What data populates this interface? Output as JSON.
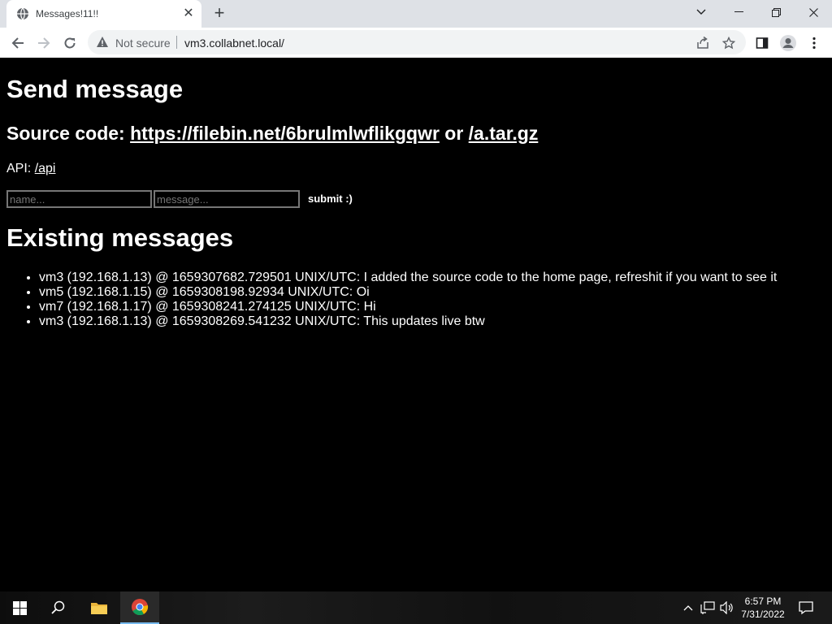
{
  "browser": {
    "tab_title": "Messages!11!!",
    "not_secure": "Not secure",
    "url": "vm3.collabnet.local/"
  },
  "page": {
    "heading": "Send message",
    "source_prefix": "Source code:",
    "source_link": "https://filebin.net/6brulmlwflikgqwr",
    "source_or": "or",
    "source_link2": "/a.tar.gz",
    "api_prefix": "API:",
    "api_link": "/api",
    "name_placeholder": "name...",
    "message_placeholder": "message...",
    "submit_label": "submit :)",
    "existing_heading": "Existing messages",
    "messages": [
      "vm3 (192.168.1.13) @ 1659307682.729501 UNIX/UTC: I added the source code to the home page, refreshit if you want to see it",
      "vm5 (192.168.1.15) @ 1659308198.92934 UNIX/UTC: Oi",
      "vm7 (192.168.1.17) @ 1659308241.274125 UNIX/UTC: Hi",
      "vm3 (192.168.1.13) @ 1659308269.541232 UNIX/UTC: This updates live btw"
    ]
  },
  "taskbar": {
    "time": "6:57 PM",
    "date": "7/31/2022"
  },
  "icons": {
    "tab_favicon": "globe-icon",
    "security": "warning-triangle-icon",
    "share": "share-icon",
    "bookmark": "star-icon",
    "side_panel": "side-panel-icon",
    "profile": "profile-icon",
    "menu": "kebab-menu-icon"
  },
  "colors": {
    "page_background": "#000000",
    "page_text": "#ffffff",
    "tabstrip": "#dee1e6",
    "taskbar_accent": "#76b9ed"
  }
}
